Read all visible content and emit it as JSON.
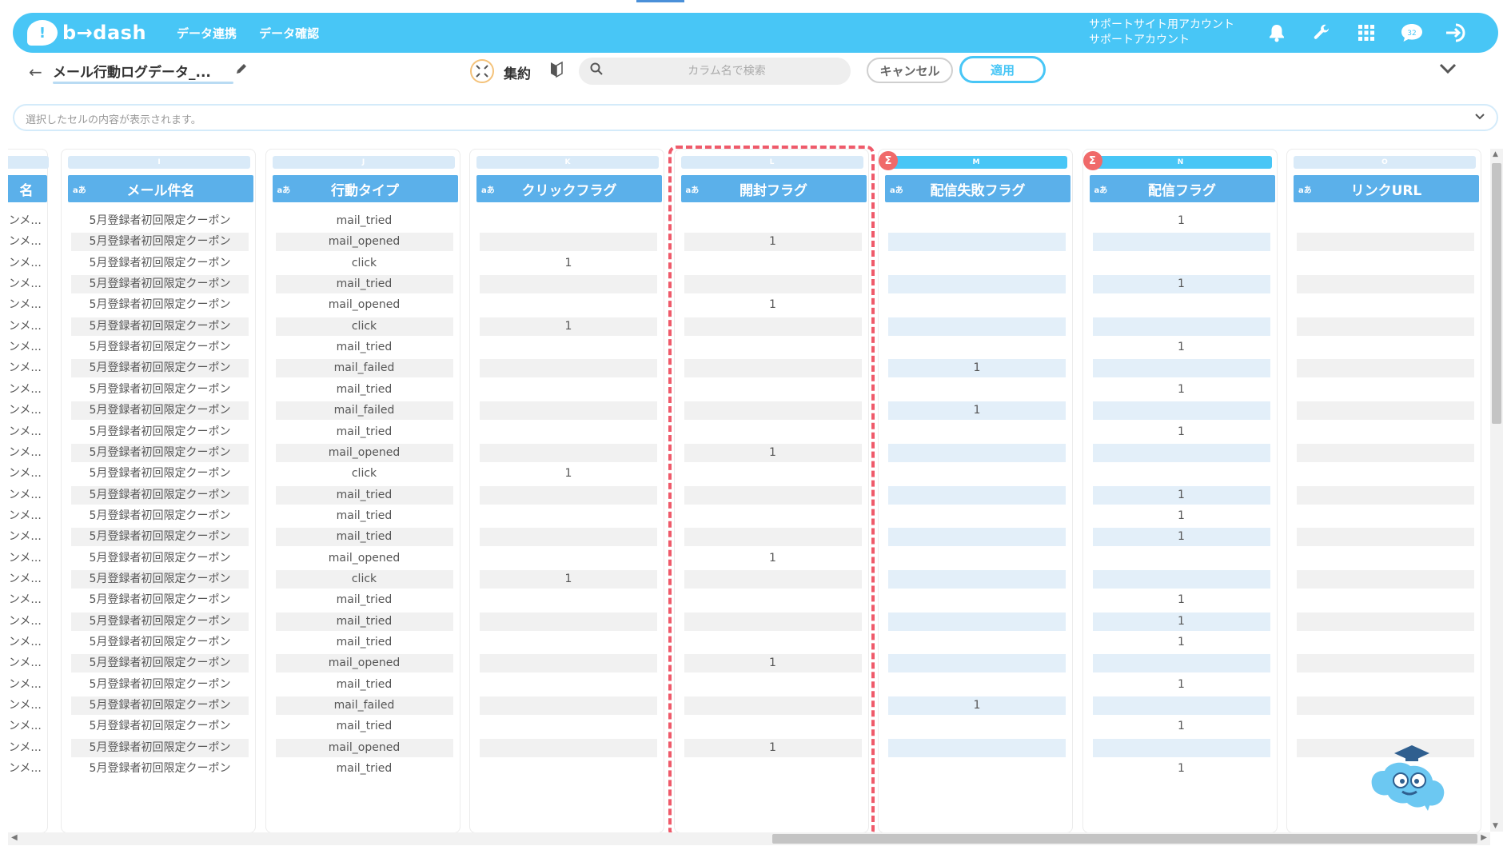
{
  "header": {
    "logo_mark": "!",
    "logo_text": "b→dash",
    "nav": [
      "データ連携",
      "データ確認"
    ],
    "account_line1": "サポートサイト用アカウント",
    "account_line2": "サポートアカウント",
    "icons": [
      "bell-icon",
      "wrench-icon",
      "grid-icon",
      "notification-icon",
      "logout-icon"
    ],
    "notification_count": "32"
  },
  "toolbar": {
    "back": "←",
    "title": "メール行動ログデータ_...",
    "aggregate_label": "集約",
    "search_placeholder": "カラム名で検索",
    "cancel_label": "キャンセル",
    "apply_label": "適用"
  },
  "cell_bar": {
    "placeholder": "選択したセルの内容が表示されます。"
  },
  "colors": {
    "header_bg": "#48c6f6",
    "column_header": "#5bb0ea",
    "highlight": "#ef5a6a",
    "sigma": "#f06a6a"
  },
  "grid": {
    "type_tag": "aあ",
    "partial_column": {
      "header": "名",
      "cell_text": "'ンメ..."
    },
    "columns": [
      {
        "letter": "I",
        "name": "メール件名",
        "active": false,
        "sigma": false,
        "alt_style": "gray"
      },
      {
        "letter": "J",
        "name": "行動タイプ",
        "active": false,
        "sigma": false,
        "alt_style": "gray"
      },
      {
        "letter": "K",
        "name": "クリックフラグ",
        "active": false,
        "sigma": false,
        "alt_style": "gray"
      },
      {
        "letter": "L",
        "name": "開封フラグ",
        "active": false,
        "sigma": false,
        "alt_style": "gray"
      },
      {
        "letter": "M",
        "name": "配信失敗フラグ",
        "active": true,
        "sigma": true,
        "alt_style": "blue"
      },
      {
        "letter": "N",
        "name": "配信フラグ",
        "active": true,
        "sigma": true,
        "alt_style": "blue"
      },
      {
        "letter": "O",
        "name": "リンクURL",
        "active": false,
        "sigma": false,
        "alt_style": "gray"
      }
    ],
    "subject_value": "5月登録者初回限定クーポン",
    "action_types": [
      "mail_tried",
      "mail_opened",
      "click",
      "mail_tried",
      "mail_opened",
      "click",
      "mail_tried",
      "mail_failed",
      "mail_tried",
      "mail_failed",
      "mail_tried",
      "mail_opened",
      "click",
      "mail_tried",
      "mail_tried",
      "mail_tried",
      "mail_opened",
      "click",
      "mail_tried",
      "mail_tried",
      "mail_tried",
      "mail_opened",
      "mail_tried",
      "mail_failed",
      "mail_tried",
      "mail_opened",
      "mail_tried"
    ],
    "click_flag": [
      "",
      "",
      "1",
      "",
      "",
      "1",
      "",
      "",
      "",
      "",
      "",
      "",
      "1",
      "",
      "",
      "",
      "",
      "1",
      "",
      "",
      "",
      "",
      "",
      "",
      "",
      "",
      ""
    ],
    "open_flag": [
      "",
      "1",
      "",
      "",
      "1",
      "",
      "",
      "",
      "",
      "",
      "",
      "1",
      "",
      "",
      "",
      "",
      "1",
      "",
      "",
      "",
      "",
      "1",
      "",
      "",
      "",
      "1",
      ""
    ],
    "failed_flag": [
      "",
      "",
      "",
      "",
      "",
      "",
      "",
      "1",
      "",
      "1",
      "",
      "",
      "",
      "",
      "",
      "",
      "",
      "",
      "",
      "",
      "",
      "",
      "",
      "1",
      "",
      "",
      ""
    ],
    "sent_flag": [
      "1",
      "",
      "",
      "1",
      "",
      "",
      "1",
      "",
      "1",
      "",
      "1",
      "",
      "",
      "1",
      "1",
      "1",
      "",
      "",
      "1",
      "1",
      "1",
      "",
      "1",
      "",
      "1",
      "",
      "1"
    ],
    "link_url": [
      "",
      "",
      "",
      "",
      "",
      "",
      "",
      "",
      "",
      "",
      "",
      "",
      "",
      "",
      "",
      "",
      "",
      "",
      "",
      "",
      "",
      "",
      "",
      "",
      "",
      "",
      ""
    ]
  }
}
